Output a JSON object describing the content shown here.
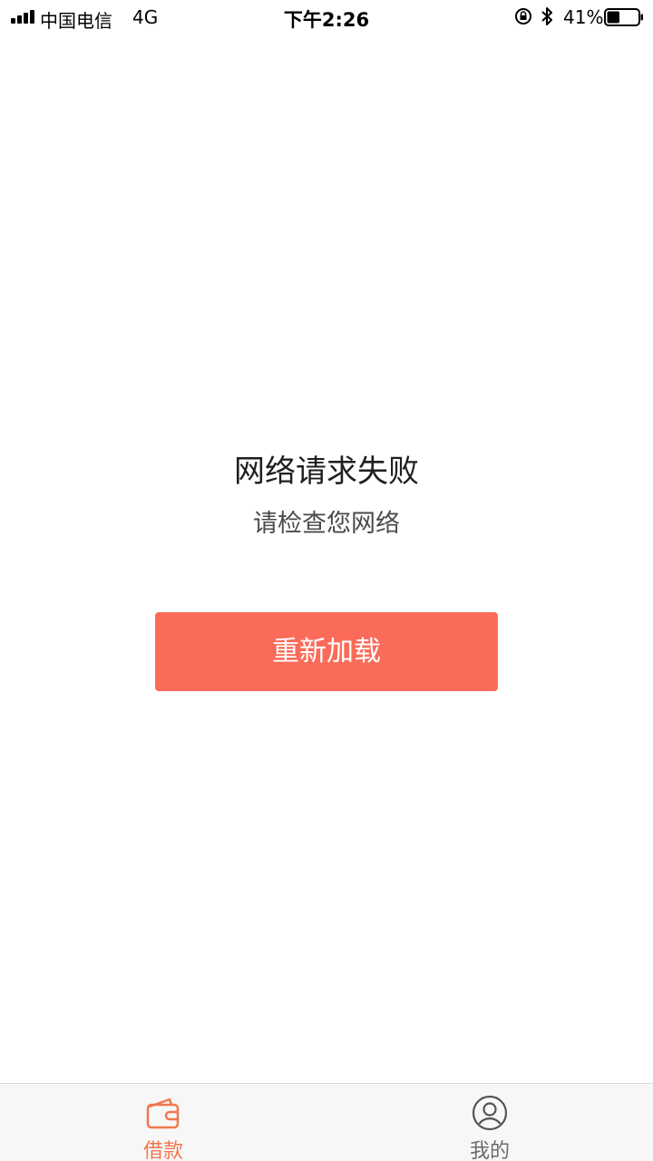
{
  "status_bar": {
    "carrier": "中国电信",
    "network": "4G",
    "time": "下午2:26",
    "battery_percent": "41%",
    "battery_level": 0.41
  },
  "error": {
    "title": "网络请求失败",
    "subtitle": "请检查您网络",
    "reload_label": "重新加载"
  },
  "tab_bar": {
    "tabs": [
      {
        "label": "借款",
        "icon": "wallet-icon",
        "active": true
      },
      {
        "label": "我的",
        "icon": "user-icon",
        "active": false
      }
    ]
  },
  "colors": {
    "accent": "#fb6b59",
    "active_tab": "#f2774c",
    "inactive_tab": "#6b6b6b"
  }
}
